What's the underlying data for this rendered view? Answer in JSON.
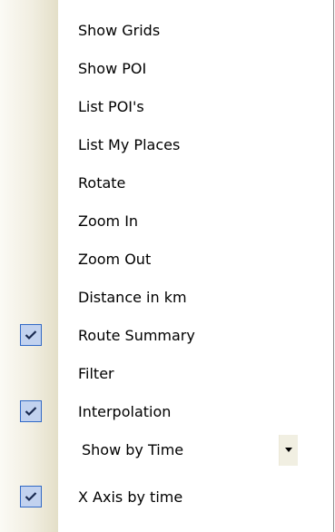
{
  "menu": {
    "items": [
      {
        "label": "Show Grids",
        "checked": false
      },
      {
        "label": "Show POI",
        "checked": false
      },
      {
        "label": "List POI's",
        "checked": false
      },
      {
        "label": "List My Places",
        "checked": false
      },
      {
        "label": "Rotate",
        "checked": false
      },
      {
        "label": "Zoom In",
        "checked": false
      },
      {
        "label": "Zoom Out",
        "checked": false
      },
      {
        "label": "Distance in km",
        "checked": false
      },
      {
        "label": "Route Summary",
        "checked": true
      },
      {
        "label": "Filter",
        "checked": false
      },
      {
        "label": "Interpolation",
        "checked": true
      }
    ],
    "combo": {
      "value": "Show by Time",
      "icon": "chevron-down-icon"
    },
    "last_item": {
      "label": "X Axis by time",
      "checked": true
    }
  },
  "colors": {
    "check_bg": "#c2d2ef",
    "check_border": "#3169c6",
    "gutter": "#ece9d8"
  }
}
